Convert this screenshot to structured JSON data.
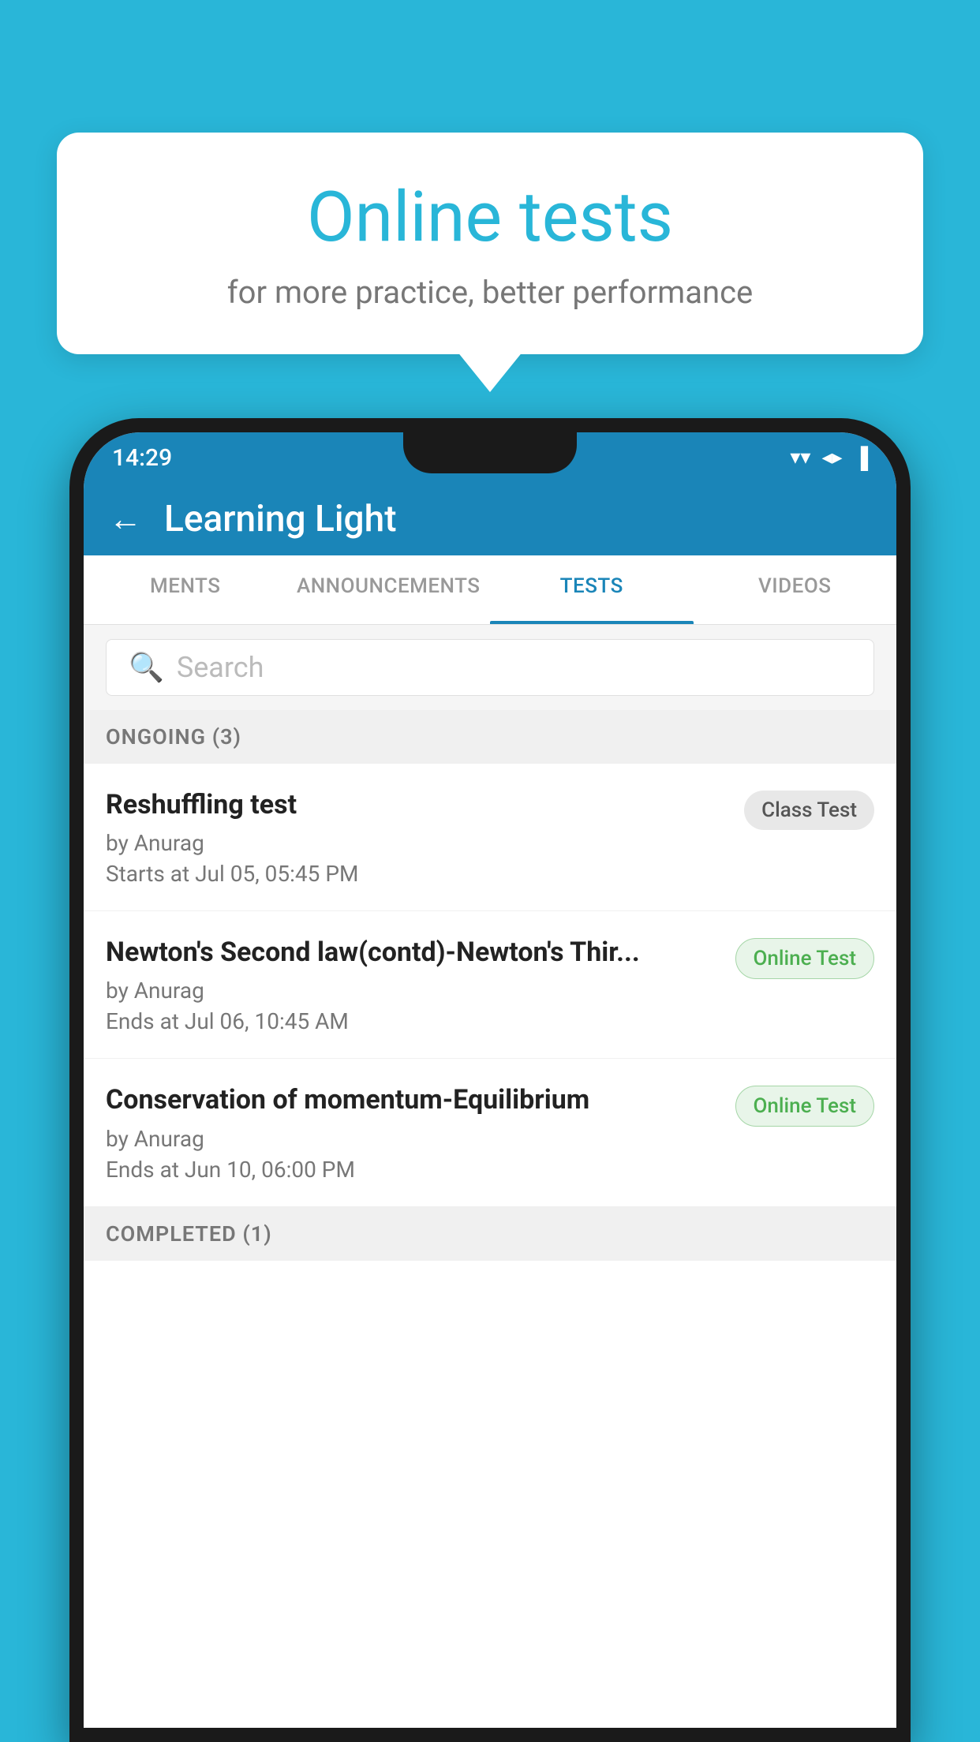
{
  "background_color": "#29b6d8",
  "speech_bubble": {
    "title": "Online tests",
    "subtitle": "for more practice, better performance"
  },
  "phone": {
    "status_bar": {
      "time": "14:29",
      "wifi_icon": "▼",
      "signal_icon": "◀",
      "battery_icon": "▮"
    },
    "header": {
      "back_label": "←",
      "title": "Learning Light"
    },
    "tabs": [
      {
        "label": "MENTS",
        "active": false
      },
      {
        "label": "ANNOUNCEMENTS",
        "active": false
      },
      {
        "label": "TESTS",
        "active": true
      },
      {
        "label": "VIDEOS",
        "active": false
      }
    ],
    "search": {
      "placeholder": "Search"
    },
    "sections": [
      {
        "title": "ONGOING (3)",
        "tests": [
          {
            "title": "Reshuffling test",
            "author": "by Anurag",
            "date": "Starts at  Jul 05, 05:45 PM",
            "badge": "Class Test",
            "badge_type": "class"
          },
          {
            "title": "Newton's Second law(contd)-Newton's Thir...",
            "author": "by Anurag",
            "date": "Ends at  Jul 06, 10:45 AM",
            "badge": "Online Test",
            "badge_type": "online"
          },
          {
            "title": "Conservation of momentum-Equilibrium",
            "author": "by Anurag",
            "date": "Ends at  Jun 10, 06:00 PM",
            "badge": "Online Test",
            "badge_type": "online"
          }
        ]
      },
      {
        "title": "COMPLETED (1)",
        "tests": []
      }
    ]
  }
}
